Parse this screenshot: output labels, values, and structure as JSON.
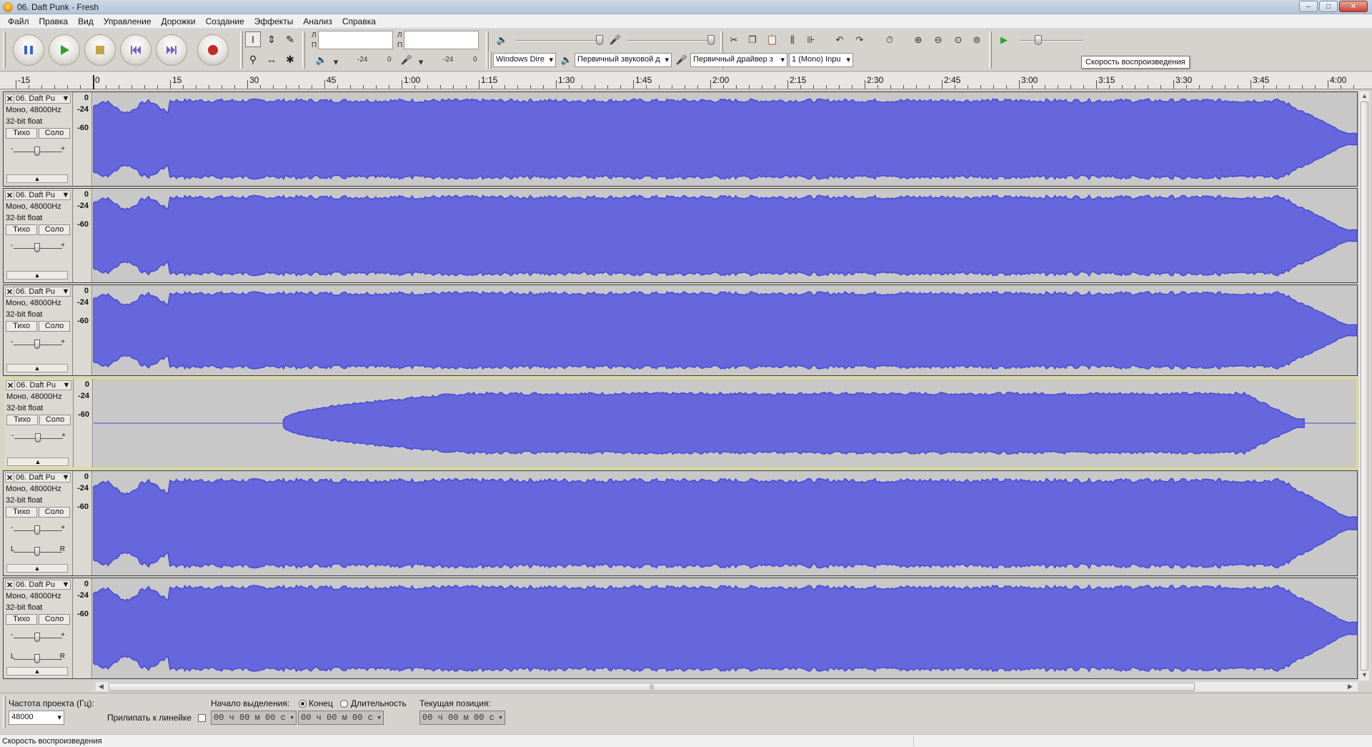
{
  "window": {
    "title": "06. Daft Punk - Fresh",
    "minimize": "–",
    "maximize": "□",
    "close": "✕"
  },
  "menu": [
    "Файл",
    "Правка",
    "Вид",
    "Управление",
    "Дорожки",
    "Создание",
    "Эффекты",
    "Анализ",
    "Справка"
  ],
  "meters": {
    "out_left": "Л",
    "out_right": "П",
    "in_left": "Л",
    "in_right": "П",
    "out_db": "-24",
    "out_zero": "0",
    "in_db": "-24",
    "in_zero": "0"
  },
  "devices": {
    "host": "Windows Dire",
    "playback": "Первичный звуковой д",
    "recording": "Первичный драйвер з",
    "channels": "1 (Mono) Inpu"
  },
  "tooltip": "Скорость воспроизведения",
  "ruler": {
    "ticks": [
      {
        "label": "-15"
      },
      {
        "label": "0"
      },
      {
        "label": "15"
      },
      {
        "label": "30"
      },
      {
        "label": "45"
      },
      {
        "label": "1:00"
      },
      {
        "label": "1:15"
      },
      {
        "label": "1:30"
      },
      {
        "label": "1:45"
      },
      {
        "label": "2:00"
      },
      {
        "label": "2:15"
      },
      {
        "label": "2:30"
      },
      {
        "label": "2:45"
      },
      {
        "label": "3:00"
      },
      {
        "label": "3:15"
      },
      {
        "label": "3:30"
      },
      {
        "label": "3:45"
      },
      {
        "label": "4:00"
      }
    ]
  },
  "track_common": {
    "format_line1": "Моно, 48000Hz",
    "format_line2": "32-bit float",
    "mute": "Тихо",
    "solo": "Соло",
    "scale": [
      "0",
      "-24",
      "-60"
    ]
  },
  "tracks": [
    {
      "name": "06. Daft Pu",
      "selected": false,
      "pan": false,
      "start": 0.0,
      "end": 1.0,
      "fade": 0.0
    },
    {
      "name": "06. Daft Pu",
      "selected": false,
      "pan": false,
      "start": 0.0,
      "end": 1.0,
      "fade": 0.0
    },
    {
      "name": "06. Daft Pu",
      "selected": false,
      "pan": false,
      "start": 0.0,
      "end": 1.0,
      "fade": 0.0
    },
    {
      "name": "06. Daft Pu",
      "selected": true,
      "pan": false,
      "start": 0.15,
      "end": 0.96,
      "fade": 0.18
    },
    {
      "name": "06. Daft Pu",
      "selected": false,
      "pan": true,
      "start": 0.0,
      "end": 1.0,
      "fade": 0.0
    },
    {
      "name": "06. Daft Pu",
      "selected": false,
      "pan": true,
      "start": 0.0,
      "end": 1.0,
      "fade": 0.0
    }
  ],
  "selection_bar": {
    "project_rate_label": "Частота проекта (Гц):",
    "project_rate": "48000",
    "snap_label": "Прилипать к линейке",
    "sel_start_label": "Начало выделения:",
    "end_label": "Конец",
    "length_label": "Длительность",
    "position_label": "Текущая позиция:",
    "time_start": "00 ч 00 м 00 с",
    "time_end": "00 ч 00 м 00 с",
    "time_pos": "00 ч 00 м 00 с"
  },
  "status": "Скорость воспроизведения",
  "colors": {
    "wave": "#4a4ad4",
    "wave_fill": "#6666dd",
    "selected_border": "#e1de77"
  }
}
